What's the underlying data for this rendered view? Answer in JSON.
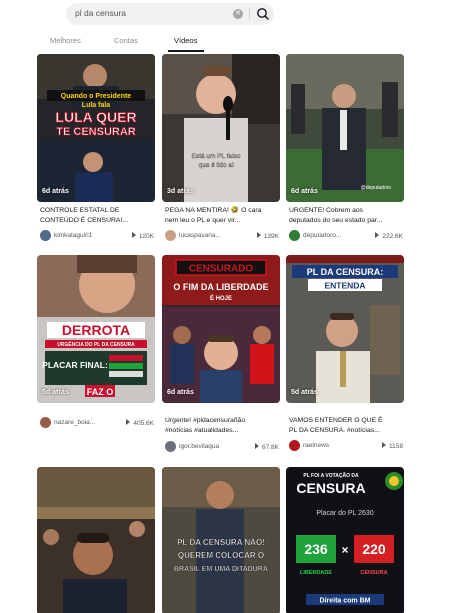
{
  "search": {
    "query": "pl da censura"
  },
  "tabs": [
    {
      "label": "Melhores"
    },
    {
      "label": "Contas"
    },
    {
      "label": "Vídeos"
    }
  ],
  "videos": [
    {
      "age": "6d atrás",
      "caption_line1": "CONTROLE ESTATAL DE",
      "caption_line2": "CONTEÚDO É CENSURA!...",
      "author": "kimkataguiri1",
      "views": "120K",
      "overlay_line1": "Quando o Presidente",
      "overlay_line2": "Lula fala",
      "overlay_line3": "LULA QUER",
      "overlay_line4": "TE CENSURAR"
    },
    {
      "age": "3d atrás",
      "caption_line1": "PEGA NA MENTIRA! 🤣 O cara",
      "caption_line2": "nem leu o PL e quer vir...",
      "author": "lucaspavana...",
      "views": "139K",
      "overlay_line1": "Está um PL falso",
      "overlay_line2": "que é lido ai"
    },
    {
      "age": "6d atrás",
      "caption_line1": "URGENTE! Cobrem aos",
      "caption_line2": "deputados do seu estado par...",
      "author": "deputadoro...",
      "views": "222.6K",
      "overlay_line1": "@deputadoro"
    },
    {
      "age": "5d atrás",
      "caption_line1": "",
      "caption_line2": "",
      "author": "nazare_boia...",
      "views": "405.6K",
      "overlay_line1": "DERROTA",
      "overlay_line2": "URGÊNCIA DO PL DA CENSURA",
      "overlay_line3": "PLACAR FINAL:",
      "overlay_line4": "FAZ O"
    },
    {
      "age": "6d atrás",
      "caption_line1": "Urgente! #pldacensurañão",
      "caption_line2": "#notícias #atualidades...",
      "author": "igor.bevilaqua",
      "views": "67.8K",
      "overlay_line1": "CENSURADO",
      "overlay_line2": "O FIM DA LIBERDADE",
      "overlay_line3": "É HOJE"
    },
    {
      "age": "5d atrás",
      "caption_line1": "VAMOS ENTENDER O QUE É",
      "caption_line2": "PL DA CENSURA. #notícias...",
      "author": "raelnews",
      "views": "1158",
      "overlay_line1": "PL DA CENSURA:",
      "overlay_line2": "ENTENDA"
    },
    {
      "age": "",
      "caption_line1": "",
      "caption_line2": "",
      "author": "",
      "views": ""
    },
    {
      "age": "",
      "caption_line1": "",
      "caption_line2": "",
      "author": "",
      "views": "",
      "overlay_line1": "PL DA CENSURA NÃO!",
      "overlay_line2": "QUEREM COLOCAR O",
      "overlay_line3": "BRASIL EM UMA DITADURA"
    },
    {
      "age": "",
      "caption_line1": "",
      "caption_line2": "",
      "author": "",
      "views": "",
      "overlay_line1": "PL FOI A VOTAÇÃO DA",
      "overlay_line2": "CENSURA",
      "overlay_line3": "Placar do PL 2630",
      "overlay_line4": "236",
      "overlay_line5": "220",
      "overlay_line6": "LIBERDADE",
      "overlay_line7": "CENSURA",
      "overlay_line8": "Direita com BM"
    }
  ],
  "colors": {
    "accent": "#fe2c55",
    "text": "#161823",
    "muted": "#8a8b91",
    "green": "#1fa33a",
    "red": "#d41f23"
  }
}
